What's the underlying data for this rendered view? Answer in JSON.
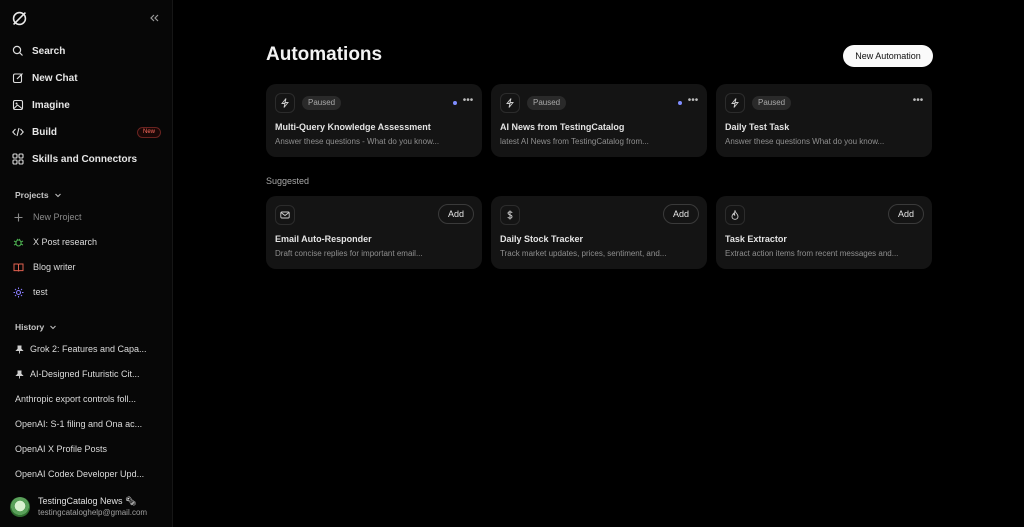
{
  "sidebar": {
    "nav": [
      {
        "label": "Search",
        "icon": "search-icon"
      },
      {
        "label": "New Chat",
        "icon": "edit-icon"
      },
      {
        "label": "Imagine",
        "icon": "image-icon"
      },
      {
        "label": "Build",
        "icon": "code-icon",
        "badge": "New"
      },
      {
        "label": "Skills and Connectors",
        "icon": "grid-icon"
      }
    ],
    "projects_header": "Projects",
    "projects": [
      {
        "label": "New Project",
        "icon": "plus-icon"
      },
      {
        "label": "X Post research",
        "icon": "bug-icon",
        "color": "#4caf50"
      },
      {
        "label": "Blog writer",
        "icon": "book-icon",
        "color": "#e0604f"
      },
      {
        "label": "test",
        "icon": "sun-icon",
        "color": "#8a7dff"
      }
    ],
    "history_header": "History",
    "history": [
      {
        "label": "Grok 2: Features and Capa...",
        "pinned": true
      },
      {
        "label": "AI-Designed Futuristic Cit...",
        "pinned": true
      },
      {
        "label": "Anthropic export controls foll...",
        "pinned": false
      },
      {
        "label": "OpenAI: S-1 filing and Ona ac...",
        "pinned": false
      },
      {
        "label": "OpenAI X Profile Posts",
        "pinned": false
      },
      {
        "label": "OpenAI Codex Developer Upd...",
        "pinned": false
      }
    ],
    "user": {
      "name": "TestingCatalog News 🗞",
      "email": "testingcataloghelp@gmail.com"
    }
  },
  "main": {
    "title": "Automations",
    "new_button": "New Automation",
    "automations": [
      {
        "status": "Paused",
        "title": "Multi-Query Knowledge Assessment",
        "desc": "Answer these questions - What do you know...",
        "dot": true
      },
      {
        "status": "Paused",
        "title": "AI News from TestingCatalog",
        "desc": "latest AI News from TestingCatalog from...",
        "dot": true
      },
      {
        "status": "Paused",
        "title": "Daily Test Task",
        "desc": "Answer these questions What do you know...",
        "dot": false
      }
    ],
    "suggested_header": "Suggested",
    "suggested": [
      {
        "icon": "mail-icon",
        "title": "Email Auto-Responder",
        "desc": "Draft concise replies for important email...",
        "add": "Add"
      },
      {
        "icon": "dollar-icon",
        "title": "Daily Stock Tracker",
        "desc": "Track market updates, prices, sentiment, and...",
        "add": "Add"
      },
      {
        "icon": "flame-icon",
        "title": "Task Extractor",
        "desc": "Extract action items from recent messages and...",
        "add": "Add"
      }
    ]
  }
}
